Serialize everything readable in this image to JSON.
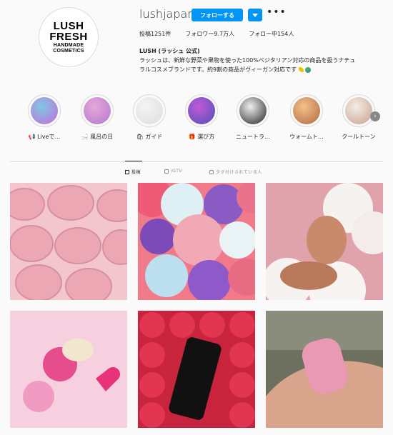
{
  "profile": {
    "logo_lines": [
      "LUSH",
      "FRESH",
      "HANDMADE",
      "COSMETICS"
    ],
    "username": "lushjapan",
    "follow_label": "フォローする",
    "posts": "投稿1251件",
    "followers": "フォロワー9.7万人",
    "following": "フォロー中154人",
    "name": "LUSH (ラッシュ 公式)",
    "bio": "ラッシュは、新鮮な野菜や果物を使った100%ベジタリアン対応の商品を扱うナチュラルコスメブランドです。約9割の商品がヴィーガン対応です"
  },
  "highlights": [
    {
      "label": "📢 Liveで…",
      "colors": [
        "#7ec8e3",
        "#c86ad8"
      ]
    },
    {
      "label": "🛁 風呂の日",
      "colors": [
        "#e8a6d8",
        "#b07ad0"
      ]
    },
    {
      "label": "🛍 ガイド",
      "colors": [
        "#f4f4f4",
        "#ddd"
      ]
    },
    {
      "label": "🎁 選び方",
      "colors": [
        "#c25ad6",
        "#5050b8"
      ]
    },
    {
      "label": "ニュートラ…",
      "colors": [
        "#f0f0f0",
        "#222"
      ]
    },
    {
      "label": "ウォームト…",
      "colors": [
        "#f4c28a",
        "#b06840"
      ]
    },
    {
      "label": "クールトーン",
      "colors": [
        "#f2ede8",
        "#c9a08a"
      ]
    }
  ],
  "tabs": {
    "posts": "投稿",
    "igtv": "IGTV",
    "tagged": "タグ付けされている人"
  },
  "colors": {
    "accent": "#0095f6",
    "border": "#dbdbdb",
    "text": "#262626",
    "muted": "#8e8e8e"
  },
  "posts": [
    {
      "alt": "pink soap bars",
      "bg": "#f0b9c3"
    },
    {
      "alt": "bath bombs",
      "bg": "#e86b84"
    },
    {
      "alt": "man in bubble bath",
      "bg": "#d99aa5"
    },
    {
      "alt": "pink bath bomb heart",
      "bg": "#f7c4da"
    },
    {
      "alt": "red shower gel bottles",
      "bg": "#d02a4a"
    },
    {
      "alt": "soap bar in hand",
      "bg": "#8a8a7a"
    }
  ]
}
